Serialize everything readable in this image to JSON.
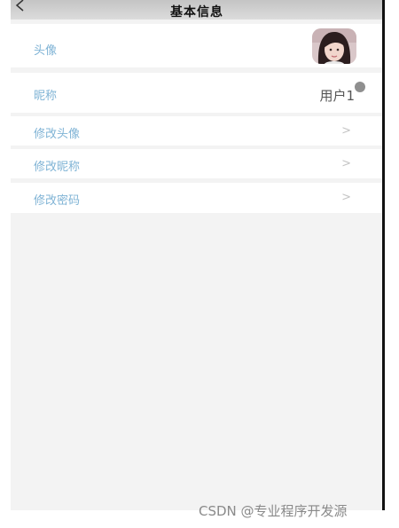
{
  "nav": {
    "back_icon": "chevron-left-icon",
    "title": "基本信息"
  },
  "rows": {
    "avatar": {
      "label": "头像"
    },
    "nickname": {
      "label": "昵称",
      "value": "用户1"
    },
    "change_avatar": {
      "label": "修改头像",
      "chevron": ">"
    },
    "change_nickname": {
      "label": "修改昵称",
      "chevron": ">"
    },
    "change_password": {
      "label": "修改密码",
      "chevron": ">"
    }
  },
  "watermark": "CSDN @专业程序开发源",
  "colors": {
    "label": "#7fb3d5",
    "background": "#f3f3f3",
    "nav": "#cfcfcf"
  }
}
